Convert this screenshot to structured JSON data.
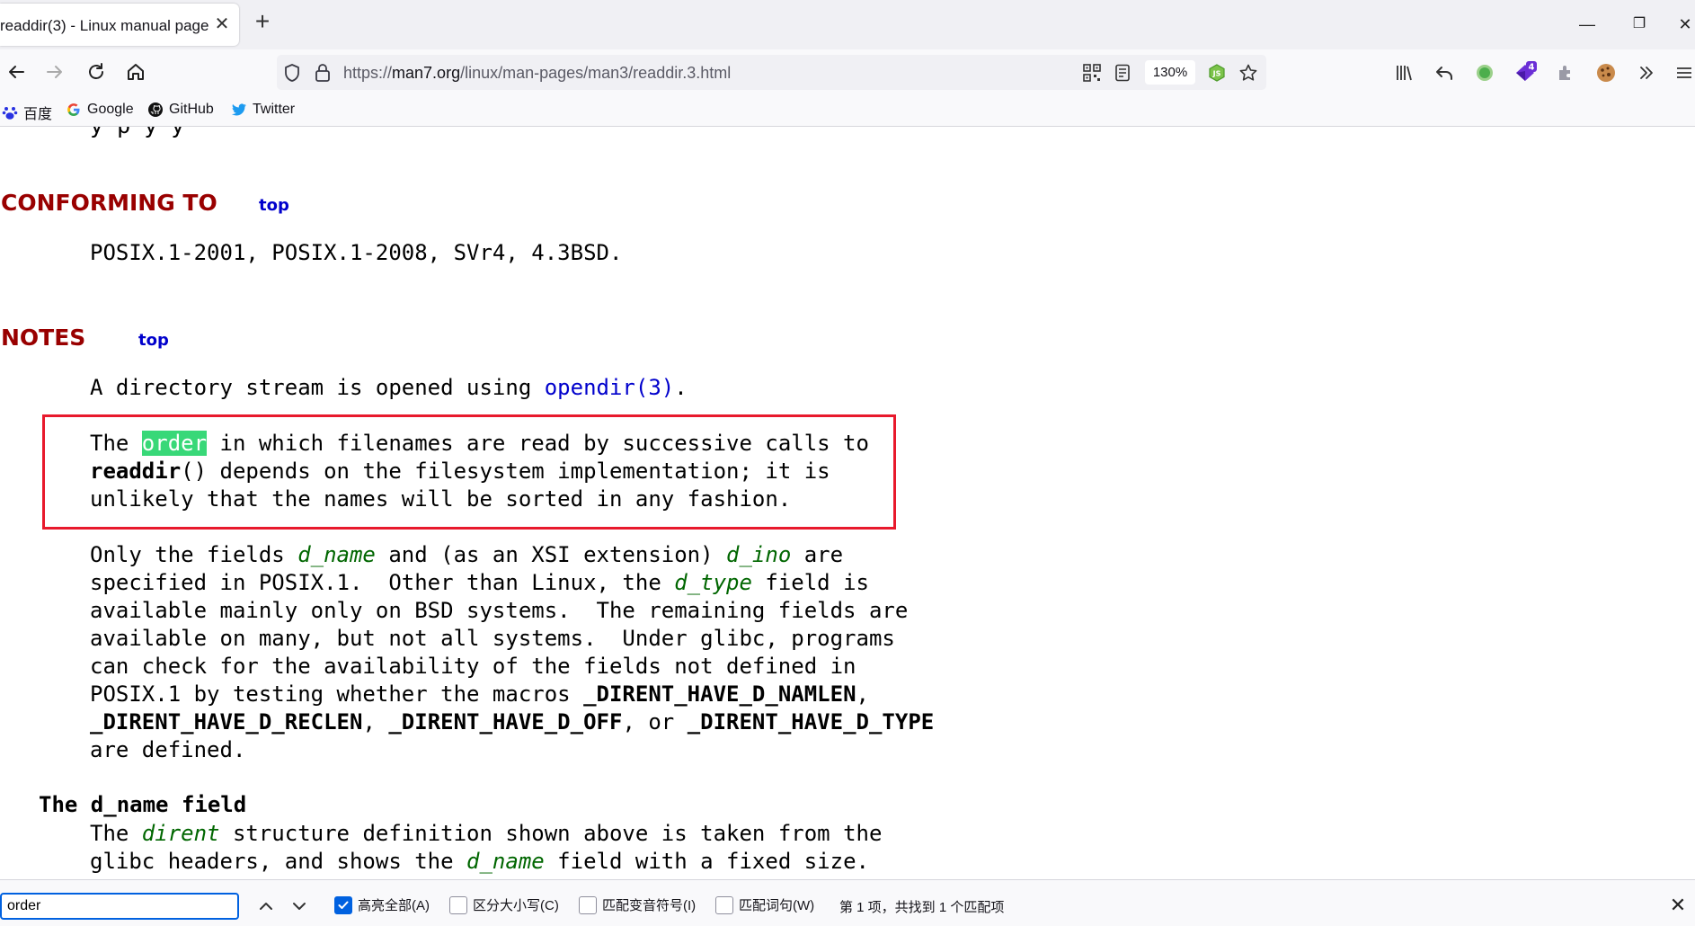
{
  "tab": {
    "title": "readdir(3) - Linux manual page",
    "close": "✕",
    "new_tab": "+"
  },
  "window": {
    "minimize": "—",
    "restore": "❐",
    "close": "✕"
  },
  "nav": {
    "url_prefix": "https://",
    "url_host": "man7.org",
    "url_path": "/linux/man-pages/man3/readdir.3.html",
    "zoom": "130%"
  },
  "bookmarks": [
    {
      "label": "百度",
      "icon": "baidu-paw-icon"
    },
    {
      "label": "Google",
      "icon": "google-g-icon"
    },
    {
      "label": "GitHub",
      "icon": "github-octocat-icon"
    },
    {
      "label": "Twitter",
      "icon": "twitter-bird-icon"
    }
  ],
  "extensions": {
    "badge_count": "4"
  },
  "content": {
    "cut_line": "y  p  y                              y",
    "conforming": {
      "heading": "CONFORMING TO",
      "top": "top",
      "text": "POSIX.1-2001, POSIX.1-2008, SVr4, 4.3BSD."
    },
    "notes": {
      "heading": "NOTES",
      "top": "top",
      "p1_pre": "A directory stream is opened using ",
      "p1_link": "opendir(3)",
      "p1_post": ".",
      "p2_l1_pre": "The ",
      "p2_l1_hl": "order",
      "p2_l1_post": " in which filenames are read by successive calls to",
      "p2_l2_bold": "readdir",
      "p2_l2_post": "() depends on the filesystem implementation; it is",
      "p2_l3": "unlikely that the names will be sorted in any fashion.",
      "p3_l1_a": "Only the fields ",
      "p3_l1_i1": "d_name",
      "p3_l1_b": " and (as an XSI extension) ",
      "p3_l1_i2": "d_ino",
      "p3_l1_c": " are",
      "p3_l2_a": "specified in POSIX.1.  Other than Linux, the ",
      "p3_l2_i": "d_type",
      "p3_l2_b": " field is",
      "p3_l3": "available mainly only on BSD systems.  The remaining fields are",
      "p3_l4": "available on many, but not all systems.  Under glibc, programs",
      "p3_l5": "can check for the availability of the fields not defined in",
      "p3_l6_a": "POSIX.1 by testing whether the macros ",
      "p3_l6_b": "_DIRENT_HAVE_D_NAMLEN",
      "p3_l6_c": ",",
      "p3_l7_b1": "_DIRENT_HAVE_D_RECLEN",
      "p3_l7_a": ", ",
      "p3_l7_b2": "_DIRENT_HAVE_D_OFF",
      "p3_l7_c": ", or ",
      "p3_l7_b3": "_DIRENT_HAVE_D_TYPE",
      "p3_l8": "are defined."
    },
    "dname": {
      "heading": "The d_name field",
      "l1_a": "The ",
      "l1_i": "dirent",
      "l1_b": " structure definition shown above is taken from the",
      "l2_a": "glibc headers, and shows the ",
      "l2_i": "d_name",
      "l2_b": " field with a fixed size."
    }
  },
  "findbar": {
    "query": "order",
    "highlight_all": "高亮全部(A)",
    "match_case": "区分大小写(C)",
    "match_diacritics": "匹配变音符号(I)",
    "whole_words": "匹配词句(W)",
    "status": "第 1 项，共找到 1 个匹配项",
    "close": "✕",
    "highlight_all_checked": true
  },
  "colors": {
    "heading": "#990000",
    "link": "#0000cc",
    "italic": "#006600",
    "highlight": "#38d878",
    "annotation_box": "#e8192c",
    "accent": "#0061e0"
  }
}
